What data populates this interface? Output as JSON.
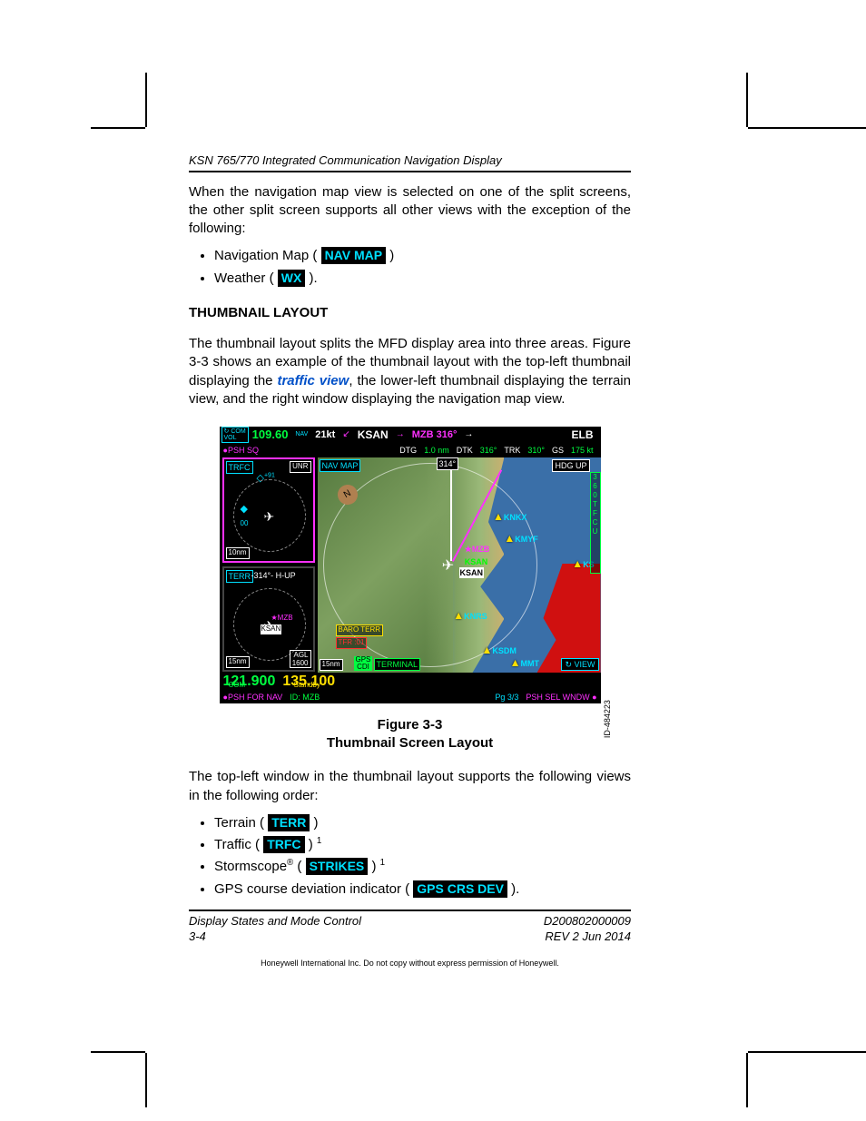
{
  "header": {
    "running": "KSN 765/770 Integrated Communication Navigation Display"
  },
  "intro": "When the navigation map view is selected on one of the split screens, the other split screen supports all other views with the exception of the following:",
  "intro_items": [
    {
      "label": "Navigation Map (",
      "key": "NAV MAP",
      "tail": ")"
    },
    {
      "label": "Weather (",
      "key": "WX",
      "tail": ")."
    }
  ],
  "section": {
    "title": "THUMBNAIL LAYOUT"
  },
  "section_para_a": "The thumbnail layout splits the MFD display area into three areas. Figure 3-3 shows an example of the thumbnail layout with the top-left thumbnail displaying the ",
  "section_para_link": "traffic view",
  "section_para_b": ", the lower-left thumbnail displaying the terrain view, and the right window displaying the navigation map view.",
  "figure": {
    "id_label": "ID-484223",
    "caption_line1": "Figure 3-3",
    "caption_line2": "Thumbnail Screen Layout"
  },
  "mfd": {
    "top1": {
      "com_vol": "COM\nVOL",
      "freq": "109.60",
      "nav": "NAV",
      "speed": "21kt",
      "wpt": "KSAN",
      "arrow1": "→",
      "next": "MZB 316°",
      "arrow2": "→",
      "dest": "ELB"
    },
    "top2": {
      "psh_sq": "PSH SQ",
      "dtg_l": "DTG",
      "dtg_v": "1.0 nm",
      "dtk_l": "DTK",
      "dtk_v": "316°",
      "trk_l": "TRK",
      "trk_v": "310°",
      "gs_l": "GS",
      "gs_v": "175 kt"
    },
    "trfc": {
      "label": "TRFC",
      "unr": "UNR",
      "tgt1": "+91",
      "tgt_alt": "00",
      "range": "10nm"
    },
    "terr": {
      "label": "TERR",
      "hdg": "-314°- H-UP",
      "wp1": "MZB",
      "wp2": "KSAN",
      "range": "15nm",
      "agl": "AGL\n1600"
    },
    "map": {
      "label": "NAV MAP",
      "hdgup": "HDG UP",
      "north": "N",
      "top_hdg": "314°",
      "baro": "BARO TERR",
      "tfr": "TFR   :01",
      "range": "15nm",
      "gps": "GPS\nCDI",
      "terminal": "TERMINAL",
      "view": "↻ VIEW",
      "wps": {
        "knkx": "KNKX",
        "kmyf": "KMYF",
        "mzb": "MZB",
        "ksan_m": "KSAN",
        "ksan_w": "KSAN",
        "knrs": "KNRS",
        "ksdm": "KSDM",
        "mmt": "MMT",
        "ks": "KS"
      },
      "side": "3\n6\n0\nT\nF\nC\nU"
    },
    "bot1": {
      "com": "121.900",
      "com_l": "COM",
      "stby": "135.100",
      "stby_l": "Standby"
    },
    "bot2": {
      "psh": "PSH FOR NAV",
      "id": "ID: MZB",
      "pg": "Pg 3/3",
      "wndw": "PSH SEL WNDW"
    }
  },
  "after_fig": "The top-left window in the thumbnail layout supports the following views in the following order:",
  "after_items": [
    {
      "label": "Terrain (",
      "key": "TERR",
      "tail": ")",
      "sup": ""
    },
    {
      "label": "Traffic (",
      "key": "TRFC",
      "tail": ") ",
      "sup": "1"
    },
    {
      "label_a": "Stormscope",
      "reg": "®",
      "label_b": " (",
      "key": "STRIKES",
      "tail": ") ",
      "sup": "1"
    },
    {
      "label": "GPS course deviation indicator (",
      "key": "GPS CRS DEV",
      "tail": ").",
      "sup": ""
    }
  ],
  "footer": {
    "left1": "Display States and Mode Control",
    "left2": "3-4",
    "right1": "D200802000009",
    "right2": "REV 2   Jun 2014",
    "micro": "Honeywell International Inc. Do not copy without express permission of Honeywell."
  }
}
